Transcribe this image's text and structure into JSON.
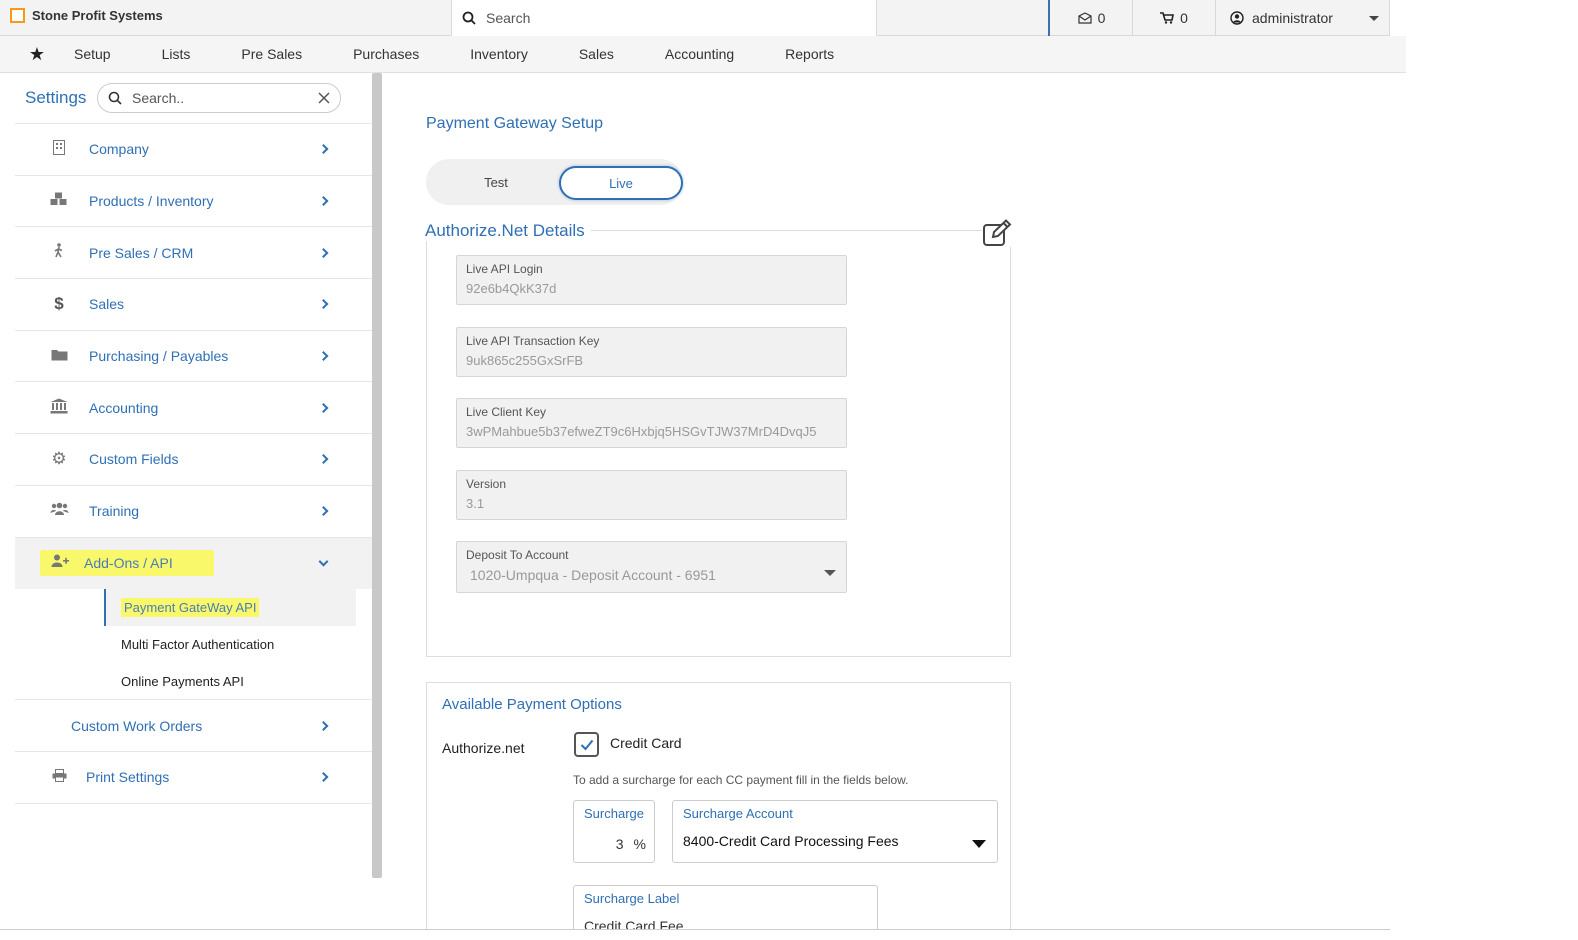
{
  "topbar": {
    "brand": "Stone Profit Systems",
    "search_placeholder": "Search",
    "mail_count": "0",
    "cart_count": "0",
    "user": "administrator"
  },
  "nav": {
    "items": [
      "Setup",
      "Lists",
      "Pre Sales",
      "Purchases",
      "Inventory",
      "Sales",
      "Accounting",
      "Reports"
    ]
  },
  "sidebar": {
    "title": "Settings",
    "search_placeholder": "Search..",
    "items": [
      {
        "label": "Company",
        "icon": "building-icon"
      },
      {
        "label": "Products / Inventory",
        "icon": "cubes-icon"
      },
      {
        "label": "Pre Sales / CRM",
        "icon": "walking-icon"
      },
      {
        "label": "Sales",
        "icon": "dollar-icon"
      },
      {
        "label": "Purchasing / Payables",
        "icon": "folder-icon"
      },
      {
        "label": "Accounting",
        "icon": "bank-icon"
      },
      {
        "label": "Custom Fields",
        "icon": "gear-icon"
      },
      {
        "label": "Training",
        "icon": "users-icon"
      },
      {
        "label": "Add-Ons / API",
        "icon": "user-plus-icon"
      }
    ],
    "subitems": [
      "Payment GateWay API",
      "Multi Factor Authentication",
      "Online Payments API"
    ],
    "after_items": [
      {
        "label": "Custom Work Orders"
      },
      {
        "label": "Print Settings",
        "icon": "printer-icon"
      }
    ]
  },
  "main": {
    "title": "Payment Gateway Setup",
    "toggle": {
      "test": "Test",
      "live": "Live"
    },
    "details_title": "Authorize.Net Details",
    "fields": [
      {
        "label": "Live API Login",
        "value": "92e6b4QkK37d"
      },
      {
        "label": "Live API Transaction Key",
        "value": "9uk865c255GxSrFB"
      },
      {
        "label": "Live Client Key",
        "value": "3wPMahbue5b37efweZT9c6Hxbjq5HSGvTJW37MrD4DvqJ5"
      },
      {
        "label": "Version",
        "value": "3.1"
      },
      {
        "label": "Deposit To Account",
        "value": "1020-Umpqua - Deposit Account - 6951"
      }
    ],
    "options": {
      "title": "Available Payment Options",
      "provider": "Authorize.net",
      "credit_card_label": "Credit Card",
      "hint": "To add a surcharge for each CC payment fill in the fields below.",
      "surcharge_label": "Surcharge",
      "surcharge_value": "3",
      "percent": "%",
      "surcharge_account_label": "Surcharge Account",
      "surcharge_account_value": "8400-Credit Card Processing Fees",
      "surcharge_text_label": "Surcharge Label",
      "surcharge_text_value": "Credit Card Fee"
    }
  },
  "colors": {
    "accent": "#2f6fb5",
    "highlight": "#f8f86a",
    "brand": "#f39a1c"
  }
}
